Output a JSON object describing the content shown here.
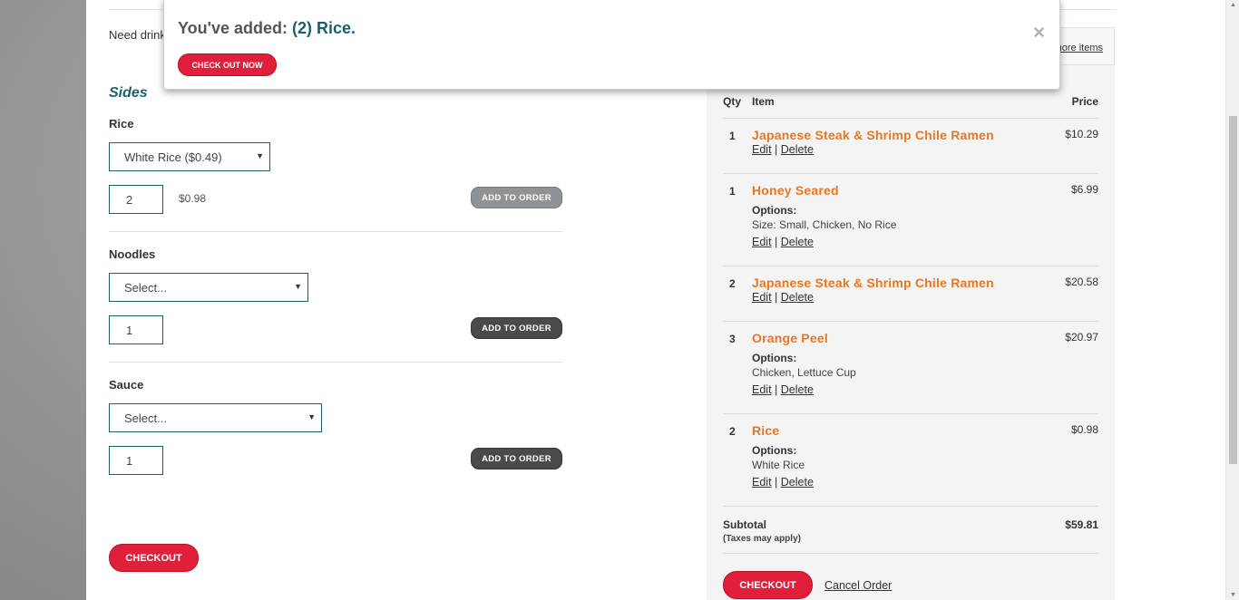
{
  "menu": {
    "need_drinks": "Need drinks",
    "sides_title": "Sides",
    "sections": [
      {
        "label": "Rice",
        "select_value": "White Rice ($0.49)",
        "qty": "2",
        "line_price": "$0.98",
        "add_label": "ADD TO ORDER"
      },
      {
        "label": "Noodles",
        "select_value": "Select...",
        "qty": "1",
        "line_price": "",
        "add_label": "ADD TO ORDER"
      },
      {
        "label": "Sauce",
        "select_value": "Select...",
        "qty": "1",
        "line_price": "",
        "add_label": "ADD TO ORDER"
      }
    ],
    "checkout_label": "CHECKOUT"
  },
  "popup": {
    "prefix": "You've added: ",
    "item": "(2) Rice",
    "suffix": ".",
    "button": "CHECK OUT NOW",
    "close": "×"
  },
  "cart": {
    "more_items": "more items",
    "headers": {
      "qty": "Qty",
      "item": "Item",
      "price": "Price"
    },
    "items": [
      {
        "qty": "1",
        "name": "Japanese Steak & Shrimp Chile Ramen",
        "price": "$10.29",
        "options_label": "",
        "options": ""
      },
      {
        "qty": "1",
        "name": "Honey Seared",
        "price": "$6.99",
        "options_label": "Options:",
        "options": "Size: Small, Chicken, No Rice"
      },
      {
        "qty": "2",
        "name": "Japanese Steak & Shrimp Chile Ramen",
        "price": "$20.58",
        "options_label": "",
        "options": ""
      },
      {
        "qty": "3",
        "name": "Orange Peel",
        "price": "$20.97",
        "options_label": "Options:",
        "options": "Chicken, Lettuce Cup"
      },
      {
        "qty": "2",
        "name": "Rice",
        "price": "$0.98",
        "options_label": "Options:",
        "options": "White Rice"
      }
    ],
    "edit": "Edit",
    "separator": "|",
    "delete": "Delete",
    "subtotal_label": "Subtotal",
    "taxes_note": "(Taxes may apply)",
    "subtotal_value": "$59.81",
    "checkout_label": "CHECKOUT",
    "cancel_label": "Cancel Order"
  },
  "colors": {
    "accent": "#e0203a",
    "brand_teal": "#1b5f6e",
    "item_orange": "#e87722"
  }
}
